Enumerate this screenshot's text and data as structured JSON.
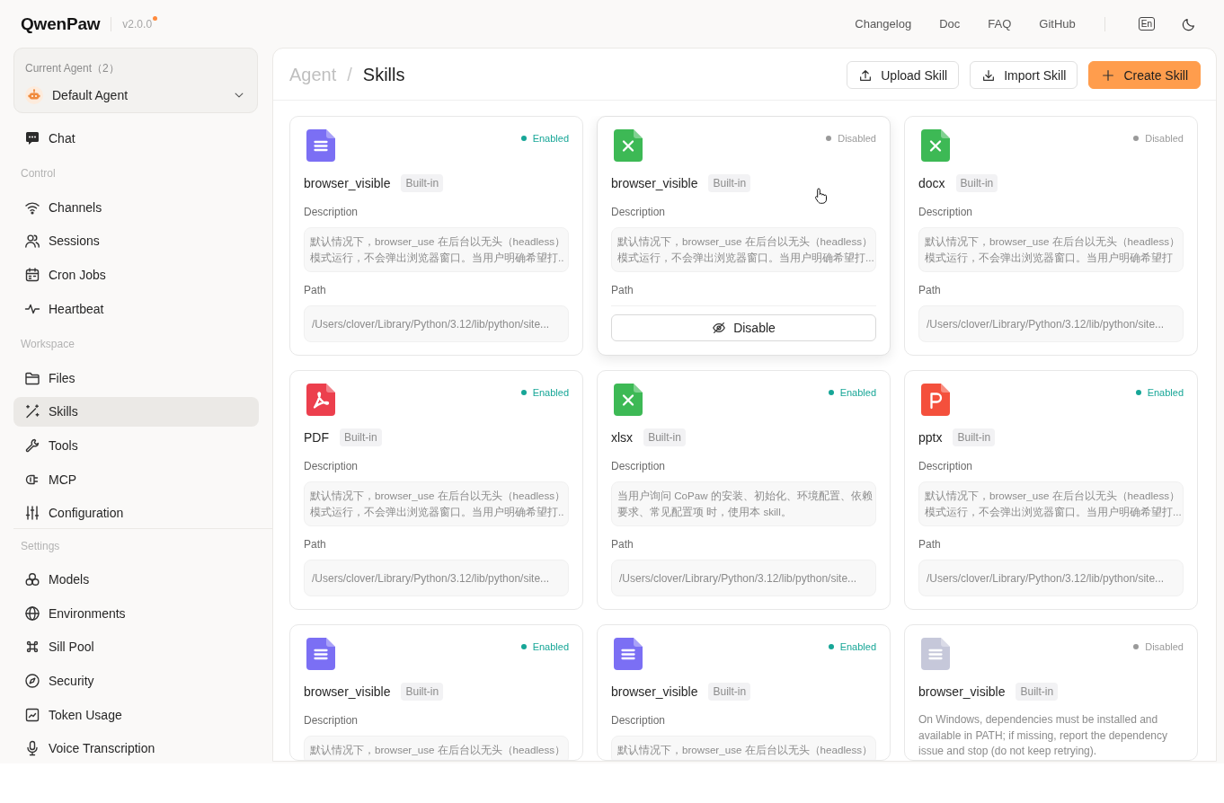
{
  "header": {
    "logo": "QwenPaw",
    "version": "v2.0.0",
    "update_available": true,
    "links": [
      "Changelog",
      "Doc",
      "FAQ",
      "GitHub"
    ],
    "language": "En"
  },
  "sidebar": {
    "agent_selector": {
      "label": "Current Agent（2）",
      "value": "Default Agent"
    },
    "nav": [
      {
        "items": [
          {
            "label": "Chat",
            "selected": false
          }
        ]
      },
      {
        "title": "Control",
        "items": [
          {
            "label": "Channels",
            "selected": false
          },
          {
            "label": "Sessions",
            "selected": false
          },
          {
            "label": "Cron Jobs",
            "selected": false
          },
          {
            "label": "Heartbeat",
            "selected": false
          }
        ]
      },
      {
        "title": "Workspace",
        "items": [
          {
            "label": "Files",
            "selected": false
          },
          {
            "label": "Skills",
            "selected": true
          },
          {
            "label": "Tools",
            "selected": false
          },
          {
            "label": "MCP",
            "selected": false
          },
          {
            "label": "Configuration",
            "selected": false
          }
        ]
      }
    ],
    "settings": {
      "title": "Settings",
      "items": [
        {
          "label": "Models",
          "selected": false
        },
        {
          "label": "Environments",
          "selected": false
        },
        {
          "label": "Sill Pool",
          "selected": false
        },
        {
          "label": "Security",
          "selected": false
        },
        {
          "label": "Token Usage",
          "selected": false
        },
        {
          "label": "Voice Transcription",
          "selected": false
        }
      ]
    }
  },
  "page": {
    "breadcrumb": {
      "parent": "Agent",
      "separator": "/",
      "current": "Skills"
    },
    "actions": [
      {
        "kind": "upload",
        "label": "Upload Skill"
      },
      {
        "kind": "import",
        "label": "Import Skill"
      },
      {
        "kind": "create",
        "label": "Create Skill"
      }
    ],
    "cards": [
      {
        "icon": {
          "kind": "doc",
          "color": "#7b6ff4"
        },
        "status": {
          "enabled": true,
          "label": "Enabled"
        },
        "hovered": false,
        "name": "browser_visible",
        "tag": "Built-in",
        "description_label": "Description",
        "description": {
          "kind": "box",
          "text": "默认情况下，browser_use 在后台以无头（headless）模式运行，不会弹出浏览器窗口。当用户明确希望打.."
        },
        "path_label": "Path",
        "path": "/Users/clover/Library/Python/3.12/lib/python/site..."
      },
      {
        "icon": {
          "kind": "sheet",
          "color": "#3db955"
        },
        "status": {
          "enabled": false,
          "label": "Disabled"
        },
        "hovered": true,
        "name": "browser_visible",
        "tag": "Built-in",
        "description_label": "Description",
        "description": {
          "kind": "box",
          "text": "默认情况下，browser_use 在后台以无头（headless）模式运行，不会弹出浏览器窗口。当用户明确希望打..."
        },
        "path_label": "Path",
        "action": "Disable"
      },
      {
        "icon": {
          "kind": "sheet",
          "color": "#3db955"
        },
        "status": {
          "enabled": false,
          "label": "Disabled"
        },
        "hovered": false,
        "name": "docx",
        "tag": "Built-in",
        "description_label": "Description",
        "description": {
          "kind": "box",
          "text": "默认情况下，browser_use 在后台以无头（headless）模式运行，不会弹出浏览器窗口。当用户明确希望打"
        },
        "path_label": "Path",
        "path": "/Users/clover/Library/Python/3.12/lib/python/site..."
      },
      {
        "icon": {
          "kind": "pdf",
          "color": "#ec3f4d"
        },
        "status": {
          "enabled": true,
          "label": "Enabled"
        },
        "hovered": false,
        "name": "PDF",
        "tag": "Built-in",
        "description_label": "Description",
        "description": {
          "kind": "box",
          "text": "默认情况下，browser_use 在后台以无头（headless）模式运行，不会弹出浏览器窗口。当用户明确希望打.."
        },
        "path_label": "Path",
        "path": "/Users/clover/Library/Python/3.12/lib/python/site..."
      },
      {
        "icon": {
          "kind": "sheet",
          "color": "#3db955"
        },
        "status": {
          "enabled": true,
          "label": "Enabled"
        },
        "hovered": false,
        "name": "xlsx",
        "tag": "Built-in",
        "description_label": "Description",
        "description": {
          "kind": "box",
          "text": "当用户询问 CoPaw 的安装、初始化、环境配置、依赖要求、常见配置项 时，使用本 skill。"
        },
        "path_label": "Path",
        "path": "/Users/clover/Library/Python/3.12/lib/python/site..."
      },
      {
        "icon": {
          "kind": "slides",
          "color": "#f4503c"
        },
        "status": {
          "enabled": true,
          "label": "Enabled"
        },
        "hovered": false,
        "name": "pptx",
        "tag": "Built-in",
        "description_label": "Description",
        "description": {
          "kind": "box",
          "text": "默认情况下，browser_use 在后台以无头（headless）模式运行，不会弹出浏览器窗口。当用户明确希望打..."
        },
        "path_label": "Path",
        "path": "/Users/clover/Library/Python/3.12/lib/python/site..."
      },
      {
        "icon": {
          "kind": "doc",
          "color": "#7b6ff4"
        },
        "status": {
          "enabled": true,
          "label": "Enabled"
        },
        "hovered": false,
        "name": "browser_visible",
        "tag": "Built-in",
        "description_label": "Description",
        "description": {
          "kind": "box",
          "text": "默认情况下，browser_use 在后台以无头（headless）"
        }
      },
      {
        "icon": {
          "kind": "doc",
          "color": "#7b6ff4"
        },
        "status": {
          "enabled": true,
          "label": "Enabled"
        },
        "hovered": false,
        "name": "browser_visible",
        "tag": "Built-in",
        "description_label": "Description",
        "description": {
          "kind": "box",
          "text": "默认情况下，browser_use 在后台以无头（headless）"
        }
      },
      {
        "icon": {
          "kind": "doc",
          "color": "#c6c8da"
        },
        "status": {
          "enabled": false,
          "label": "Disabled"
        },
        "hovered": false,
        "name": "browser_visible",
        "tag": "Built-in",
        "description": {
          "kind": "plain",
          "text": "On Windows, dependencies must be installed and\navailable in PATH; if missing, report the dependency\nissue and stop (do not keep retrying)."
        }
      }
    ]
  }
}
